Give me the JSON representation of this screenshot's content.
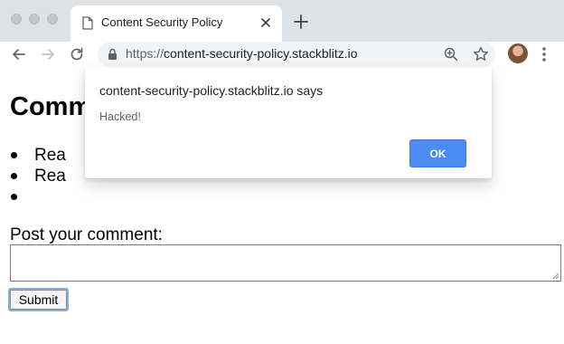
{
  "browser": {
    "tab": {
      "title": "Content Security Policy"
    },
    "address_bar": {
      "scheme": "https://",
      "host": "content-security-policy.stackblitz.io"
    },
    "icons": {
      "back": "arrow-left-icon",
      "forward": "arrow-right-icon",
      "reload": "reload-icon",
      "lock": "lock-icon",
      "zoom": "zoom-in-icon",
      "bookmark": "star-icon",
      "menu": "kebab-menu-icon",
      "new_tab": "plus-icon",
      "close_tab": "close-icon"
    }
  },
  "page": {
    "heading": "Comm",
    "comments": [
      "Rea",
      "Rea",
      ""
    ],
    "post_label": "Post your comment:",
    "comment_value": "",
    "submit_label": "Submit"
  },
  "dialog": {
    "title": "content-security-policy.stackblitz.io says",
    "message": "Hacked!",
    "ok_label": "OK"
  },
  "colors": {
    "chrome_bg": "#dee1e6",
    "omnibox_bg": "#f1f3f4",
    "ok_button": "#4c8bf5",
    "submit_focus_ring": "#7fb1e6"
  }
}
